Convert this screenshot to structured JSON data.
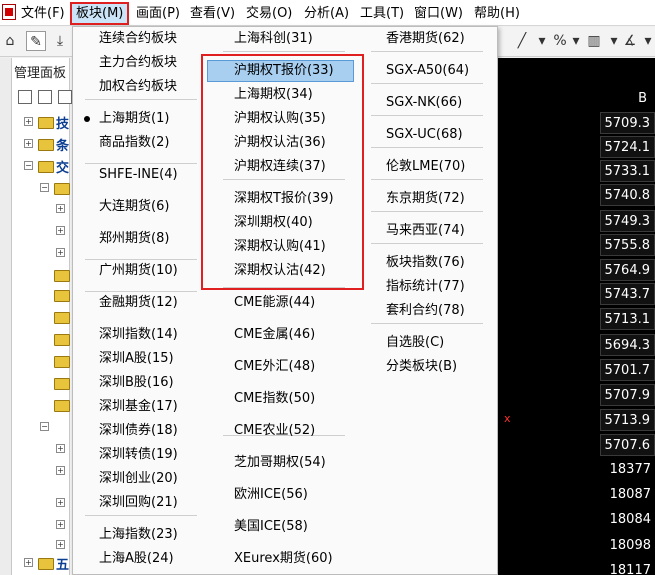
{
  "menubar": {
    "items": [
      "文件(F)",
      "板块(M)",
      "画面(P)",
      "查看(V)",
      "交易(O)",
      "分析(A)",
      "工具(T)",
      "窗口(W)",
      "帮助(H)"
    ]
  },
  "left_panel": {
    "title": "管理面板",
    "tree": [
      "技",
      "条",
      "交",
      "五"
    ]
  },
  "data_panel": {
    "header": "B",
    "values": [
      "5709.3",
      "5724.1",
      "5733.1",
      "5740.8",
      "5749.3",
      "5755.8",
      "5764.9",
      "5743.7",
      "5713.1",
      "5694.3",
      "5701.7",
      "5707.9",
      "5713.9",
      "5707.6",
      "18377",
      "18087",
      "18084",
      "18098",
      "18117"
    ],
    "marker": "x"
  },
  "dropdown": {
    "col1": [
      "连续合约板块",
      "主力合约板块",
      "加权合约板块",
      "上海期货(1)",
      "商品指数(2)",
      "SHFE-INE(4)",
      "大连期货(6)",
      "郑州期货(8)",
      "广州期货(10)",
      "金融期货(12)",
      "深圳指数(14)",
      "深圳A股(15)",
      "深圳B股(16)",
      "深圳基金(17)",
      "深圳债券(18)",
      "深圳转债(19)",
      "深圳创业(20)",
      "深圳回购(21)",
      "上海指数(23)",
      "上海A股(24)"
    ],
    "col2": [
      "上海科创(31)",
      "沪期权T报价(33)",
      "上海期权(34)",
      "沪期权认购(35)",
      "沪期权认沽(36)",
      "沪期权连续(37)",
      "深期权T报价(39)",
      "深圳期权(40)",
      "深期权认购(41)",
      "深期权认沽(42)",
      "CME能源(44)",
      "CME金属(46)",
      "CME外汇(48)",
      "CME指数(50)",
      "CME农业(52)",
      "芝加哥期权(54)",
      "欧洲ICE(56)",
      "美国ICE(58)",
      "XEurex期货(60)"
    ],
    "col3": [
      "香港期货(62)",
      "SGX-A50(64)",
      "SGX-NK(66)",
      "SGX-UC(68)",
      "伦敦LME(70)",
      "东京期货(72)",
      "马来西亚(74)",
      "板块指数(76)",
      "指标统计(77)",
      "套利合约(78)",
      "自选股(C)",
      "分类板块(B)"
    ]
  }
}
